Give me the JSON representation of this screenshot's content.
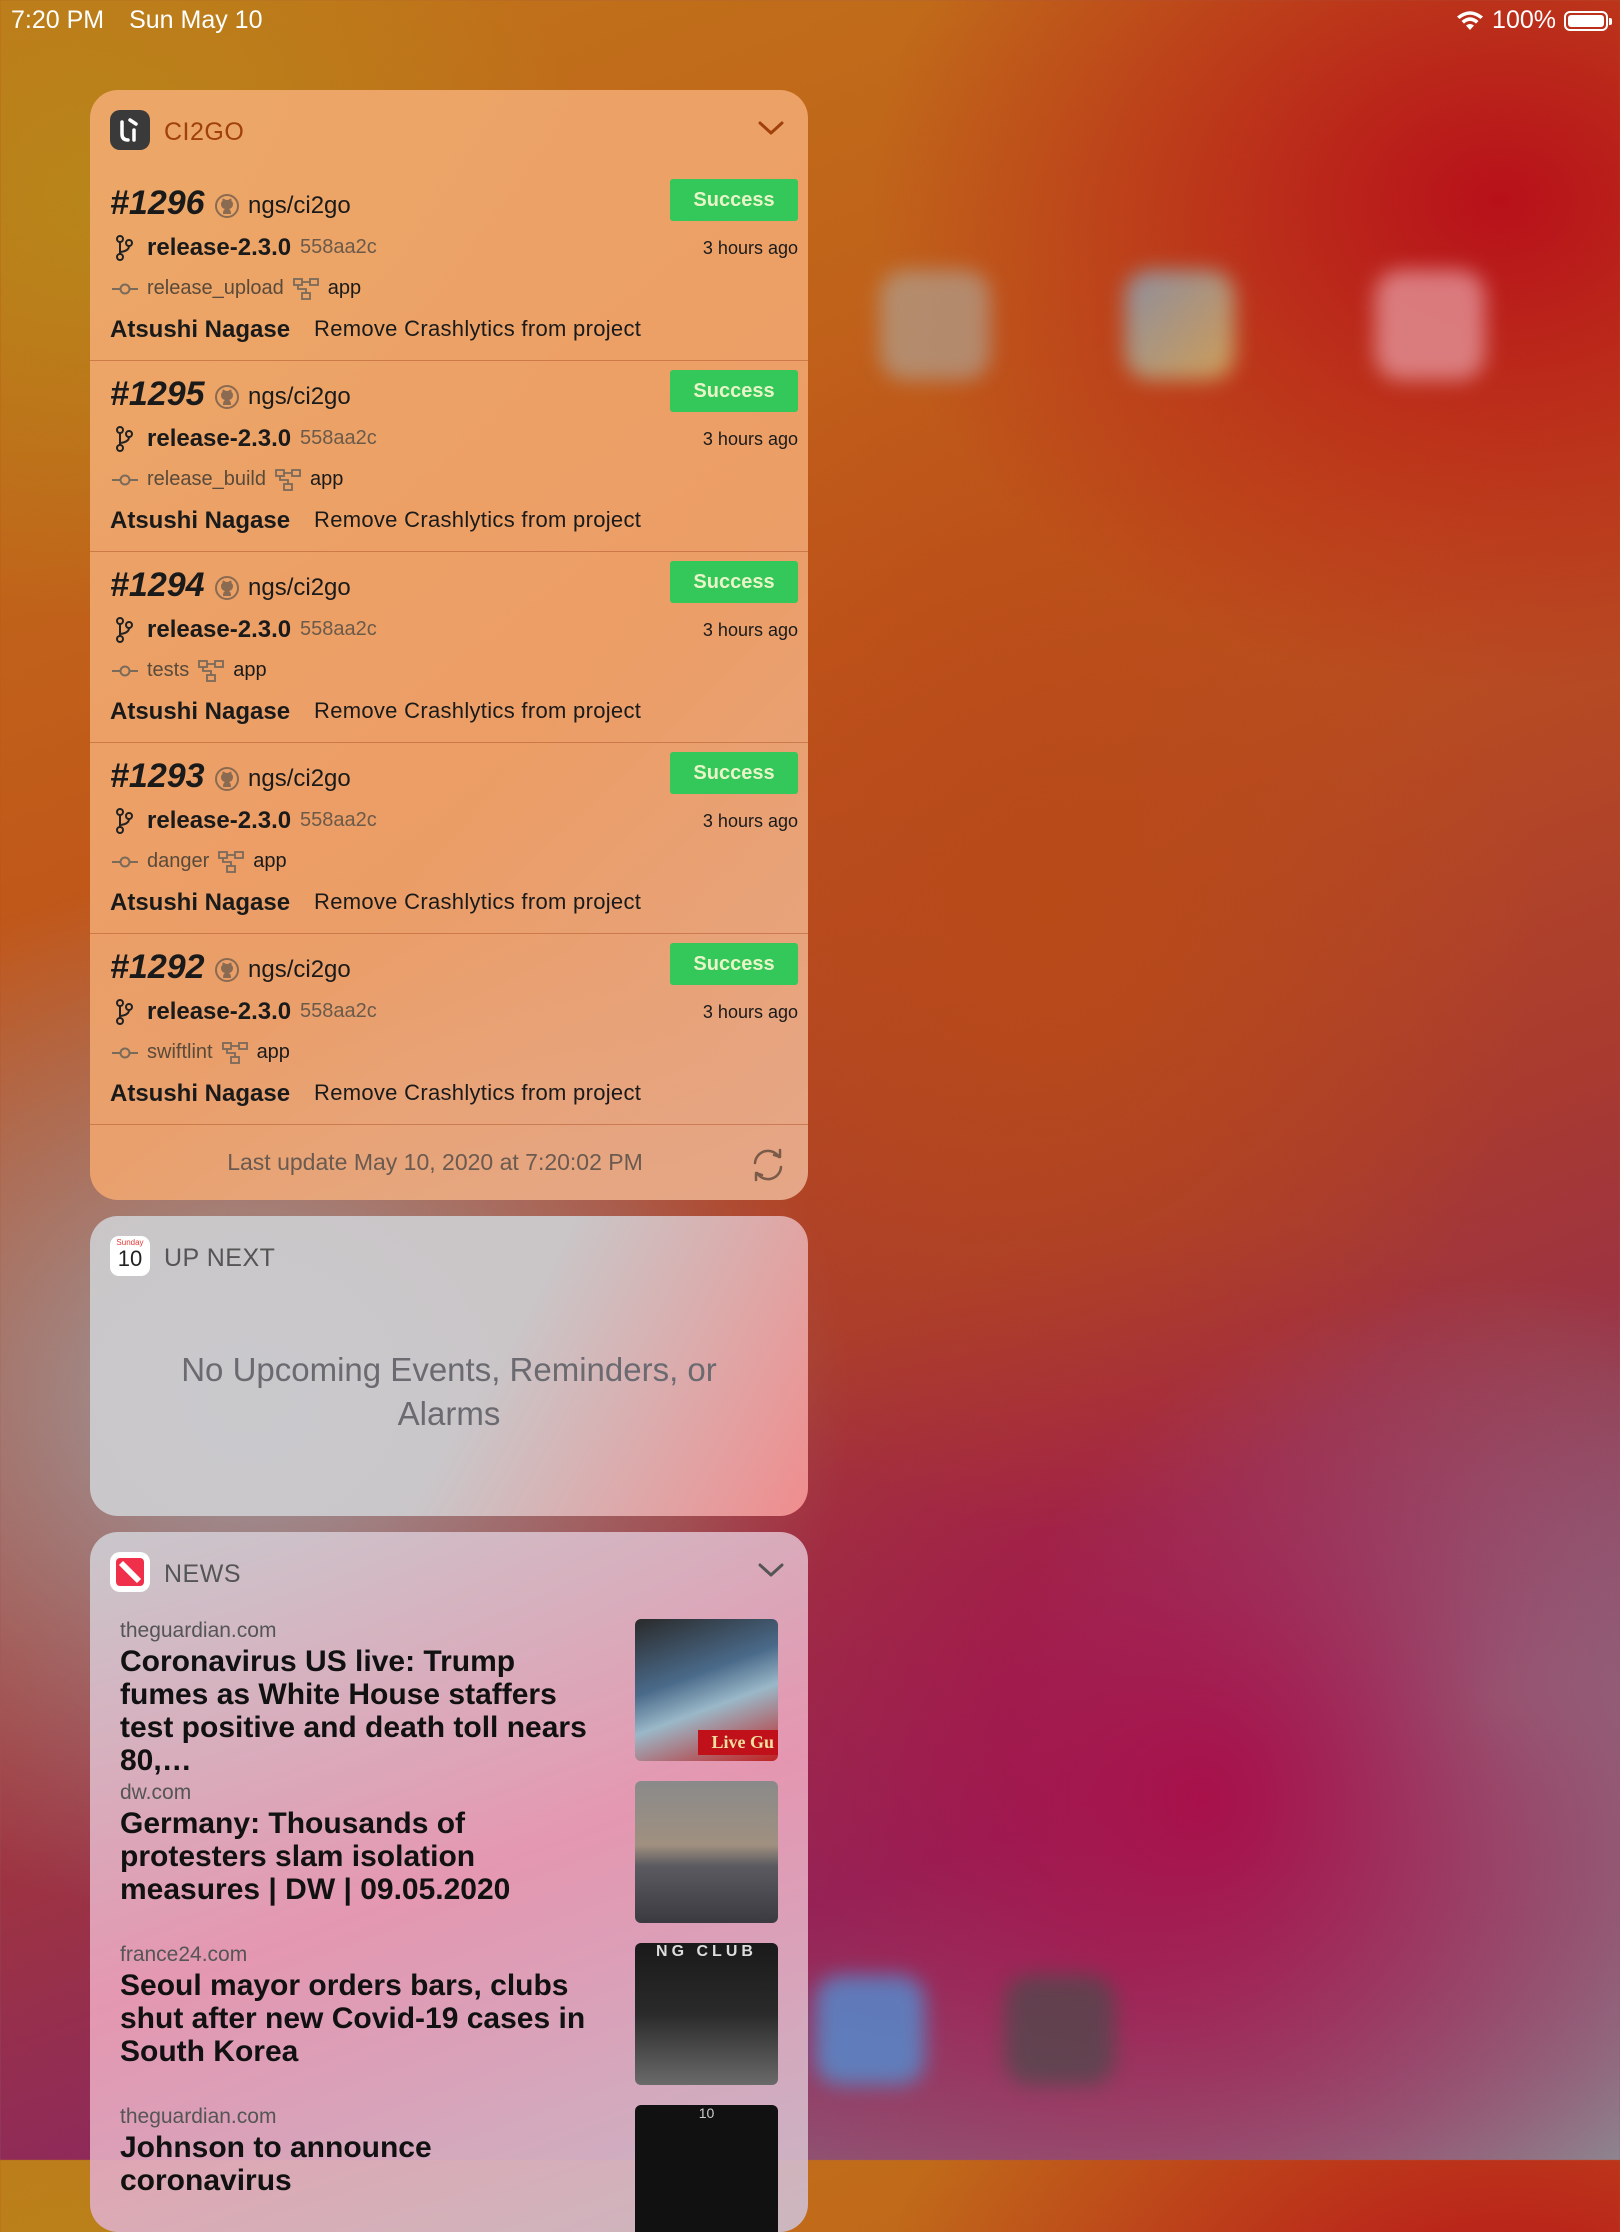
{
  "status": {
    "time": "7:20 PM",
    "date": "Sun May 10",
    "battery": "100%",
    "battery_level": 1.0
  },
  "ci2go": {
    "title": "CI2GO",
    "builds": [
      {
        "num": "#1296",
        "repo": "ngs/ci2go",
        "status": "Success",
        "branch": "release-2.3.0",
        "sha": "558aa2c",
        "ago": "3 hours ago",
        "job": "release_upload",
        "workflow": "app",
        "author": "Atsushi Nagase",
        "message": "Remove Crashlytics from project"
      },
      {
        "num": "#1295",
        "repo": "ngs/ci2go",
        "status": "Success",
        "branch": "release-2.3.0",
        "sha": "558aa2c",
        "ago": "3 hours ago",
        "job": "release_build",
        "workflow": "app",
        "author": "Atsushi Nagase",
        "message": "Remove Crashlytics from project"
      },
      {
        "num": "#1294",
        "repo": "ngs/ci2go",
        "status": "Success",
        "branch": "release-2.3.0",
        "sha": "558aa2c",
        "ago": "3 hours ago",
        "job": "tests",
        "workflow": "app",
        "author": "Atsushi Nagase",
        "message": "Remove Crashlytics from project"
      },
      {
        "num": "#1293",
        "repo": "ngs/ci2go",
        "status": "Success",
        "branch": "release-2.3.0",
        "sha": "558aa2c",
        "ago": "3 hours ago",
        "job": "danger",
        "workflow": "app",
        "author": "Atsushi Nagase",
        "message": "Remove Crashlytics from project"
      },
      {
        "num": "#1292",
        "repo": "ngs/ci2go",
        "status": "Success",
        "branch": "release-2.3.0",
        "sha": "558aa2c",
        "ago": "3 hours ago",
        "job": "swiftlint",
        "workflow": "app",
        "author": "Atsushi Nagase",
        "message": "Remove Crashlytics from project"
      }
    ],
    "last_update": "Last update May 10, 2020 at 7:20:02 PM"
  },
  "upnext": {
    "title": "UP NEXT",
    "cal_day": "Sunday",
    "cal_date": "10",
    "empty_message": "No Upcoming Events, Reminders, or Alarms"
  },
  "news": {
    "title": "NEWS",
    "items": [
      {
        "source": "theguardian.com",
        "headline": "Coronavirus US live: Trump fumes as White House staffers test positive and death toll nears 80,…",
        "thumb_text": "Live Gu"
      },
      {
        "source": "dw.com",
        "headline": "Germany: Thousands of protesters slam isolation measures | DW | 09.05.2020"
      },
      {
        "source": "france24.com",
        "headline": "Seoul mayor orders bars, clubs shut after new Covid-19 cases in South Korea",
        "thumb_text": "NG CLUB"
      },
      {
        "source": "theguardian.com",
        "headline": "Johnson to announce coronavirus",
        "thumb_text": "10"
      }
    ]
  },
  "colors": {
    "success": "#34c759",
    "accent_ci": "#a0400a"
  }
}
